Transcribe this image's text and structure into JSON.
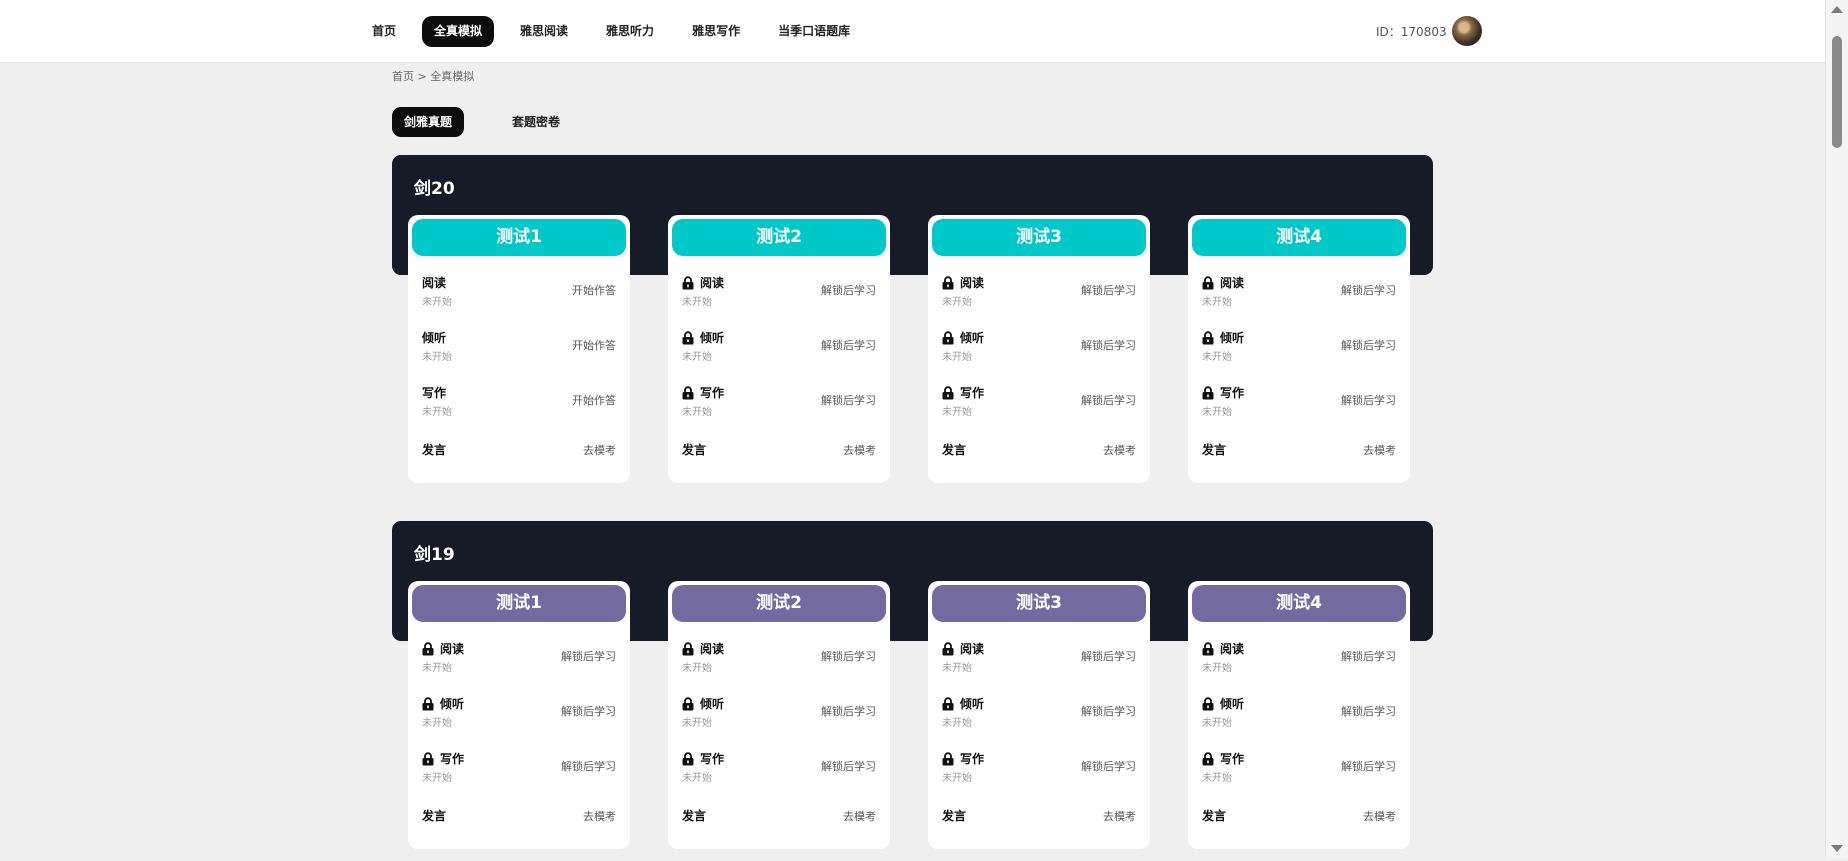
{
  "nav": {
    "items": [
      {
        "label": "首页",
        "active": false
      },
      {
        "label": "全真模拟",
        "active": true
      },
      {
        "label": "雅思阅读",
        "active": false
      },
      {
        "label": "雅思听力",
        "active": false
      },
      {
        "label": "雅思写作",
        "active": false
      },
      {
        "label": "当季口语题库",
        "active": false
      }
    ],
    "user_id": "ID：170803"
  },
  "breadcrumb": "首页 > 全真模拟",
  "tabs": [
    {
      "label": "剑雅真题",
      "active": true
    },
    {
      "label": "套题密卷",
      "active": false
    }
  ],
  "colors": {
    "accent_teal": "#00c8c8",
    "accent_purple": "#736ba0",
    "band": "#171a27"
  },
  "sections": [
    {
      "title": "剑20",
      "header_color": "#00c8c8",
      "tests": [
        {
          "name": "测试1",
          "rows": [
            {
              "name": "阅读",
              "status": "未开始",
              "action": "开始作答",
              "locked": false
            },
            {
              "name": "倾听",
              "status": "未开始",
              "action": "开始作答",
              "locked": false
            },
            {
              "name": "写作",
              "status": "未开始",
              "action": "开始作答",
              "locked": false
            }
          ],
          "speak": {
            "name": "发言",
            "action": "去模考"
          }
        },
        {
          "name": "测试2",
          "rows": [
            {
              "name": "阅读",
              "status": "未开始",
              "action": "解锁后学习",
              "locked": true
            },
            {
              "name": "倾听",
              "status": "未开始",
              "action": "解锁后学习",
              "locked": true
            },
            {
              "name": "写作",
              "status": "未开始",
              "action": "解锁后学习",
              "locked": true
            }
          ],
          "speak": {
            "name": "发言",
            "action": "去模考"
          }
        },
        {
          "name": "测试3",
          "rows": [
            {
              "name": "阅读",
              "status": "未开始",
              "action": "解锁后学习",
              "locked": true
            },
            {
              "name": "倾听",
              "status": "未开始",
              "action": "解锁后学习",
              "locked": true
            },
            {
              "name": "写作",
              "status": "未开始",
              "action": "解锁后学习",
              "locked": true
            }
          ],
          "speak": {
            "name": "发言",
            "action": "去模考"
          }
        },
        {
          "name": "测试4",
          "rows": [
            {
              "name": "阅读",
              "status": "未开始",
              "action": "解锁后学习",
              "locked": true
            },
            {
              "name": "倾听",
              "status": "未开始",
              "action": "解锁后学习",
              "locked": true
            },
            {
              "name": "写作",
              "status": "未开始",
              "action": "解锁后学习",
              "locked": true
            }
          ],
          "speak": {
            "name": "发言",
            "action": "去模考"
          }
        }
      ]
    },
    {
      "title": "剑19",
      "header_color": "#736ba0",
      "tests": [
        {
          "name": "测试1",
          "rows": [
            {
              "name": "阅读",
              "status": "未开始",
              "action": "解锁后学习",
              "locked": true
            },
            {
              "name": "倾听",
              "status": "未开始",
              "action": "解锁后学习",
              "locked": true
            },
            {
              "name": "写作",
              "status": "未开始",
              "action": "解锁后学习",
              "locked": true
            }
          ],
          "speak": {
            "name": "发言",
            "action": "去模考"
          }
        },
        {
          "name": "测试2",
          "rows": [
            {
              "name": "阅读",
              "status": "未开始",
              "action": "解锁后学习",
              "locked": true
            },
            {
              "name": "倾听",
              "status": "未开始",
              "action": "解锁后学习",
              "locked": true
            },
            {
              "name": "写作",
              "status": "未开始",
              "action": "解锁后学习",
              "locked": true
            }
          ],
          "speak": {
            "name": "发言",
            "action": "去模考"
          }
        },
        {
          "name": "测试3",
          "rows": [
            {
              "name": "阅读",
              "status": "未开始",
              "action": "解锁后学习",
              "locked": true
            },
            {
              "name": "倾听",
              "status": "未开始",
              "action": "解锁后学习",
              "locked": true
            },
            {
              "name": "写作",
              "status": "未开始",
              "action": "解锁后学习",
              "locked": true
            }
          ],
          "speak": {
            "name": "发言",
            "action": "去模考"
          }
        },
        {
          "name": "测试4",
          "rows": [
            {
              "name": "阅读",
              "status": "未开始",
              "action": "解锁后学习",
              "locked": true
            },
            {
              "name": "倾听",
              "status": "未开始",
              "action": "解锁后学习",
              "locked": true
            },
            {
              "name": "写作",
              "status": "未开始",
              "action": "解锁后学习",
              "locked": true
            }
          ],
          "speak": {
            "name": "发言",
            "action": "去模考"
          }
        }
      ]
    }
  ]
}
